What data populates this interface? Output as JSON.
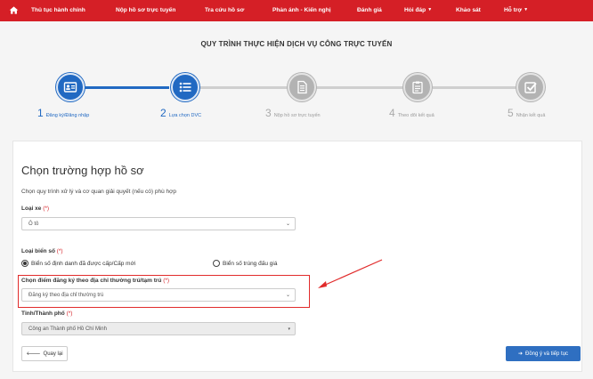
{
  "nav": {
    "items": [
      {
        "label": "Thủ tục hành chính"
      },
      {
        "label": "Nộp hồ sơ trực tuyến"
      },
      {
        "label": "Tra cứu hồ sơ"
      },
      {
        "label": "Phản ánh - Kiến nghị"
      },
      {
        "label": "Đánh giá"
      },
      {
        "label": "Hỏi đáp"
      },
      {
        "label": "Khảo sát"
      },
      {
        "label": "Hỗ trợ"
      }
    ]
  },
  "page": {
    "title": "QUY TRÌNH THỰC HIỆN DỊCH VỤ CÔNG TRỰC TUYẾN"
  },
  "steps": [
    {
      "num": "1",
      "label": "Đăng ký/Đăng nhập",
      "icon": "id-card-icon",
      "state": "active"
    },
    {
      "num": "2",
      "label": "Lựa chọn DVC",
      "icon": "list-icon",
      "state": "active"
    },
    {
      "num": "3",
      "label": "Nộp hồ sơ trực tuyến",
      "icon": "document-icon",
      "state": "inactive"
    },
    {
      "num": "4",
      "label": "Theo dõi kết quả",
      "icon": "clipboard-icon",
      "state": "inactive"
    },
    {
      "num": "5",
      "label": "Nhận kết quả",
      "icon": "checkbox-icon",
      "state": "inactive"
    }
  ],
  "form": {
    "title": "Chọn trường hợp hồ sơ",
    "description": "Chọn quy trình xử lý và cơ quan giải quyết (nếu có) phù hợp",
    "required_mark": "(*)",
    "vehicle_type": {
      "label": "Loại xe",
      "value": "Ô tô"
    },
    "plate_type": {
      "label": "Loại biển số",
      "options": [
        "Biển số định danh đã được cấp/Cấp mới",
        "Biển số trúng đấu giá"
      ],
      "selected": 0
    },
    "registration_place": {
      "label": "Chọn điểm đăng ký theo địa chỉ thường trú/tạm trú",
      "value": "Đăng ký theo địa chỉ thường trú"
    },
    "province": {
      "label": "Tỉnh/Thành phố",
      "value": "Công an Thành phố Hồ Chí Minh"
    },
    "back_button": "Quay lại",
    "next_button": "Đồng ý và tiếp tục"
  },
  "colors": {
    "nav": "#d51f26",
    "primary": "#2169c2",
    "inactive": "#b3b3b3",
    "highlight": "#e12b2b"
  }
}
